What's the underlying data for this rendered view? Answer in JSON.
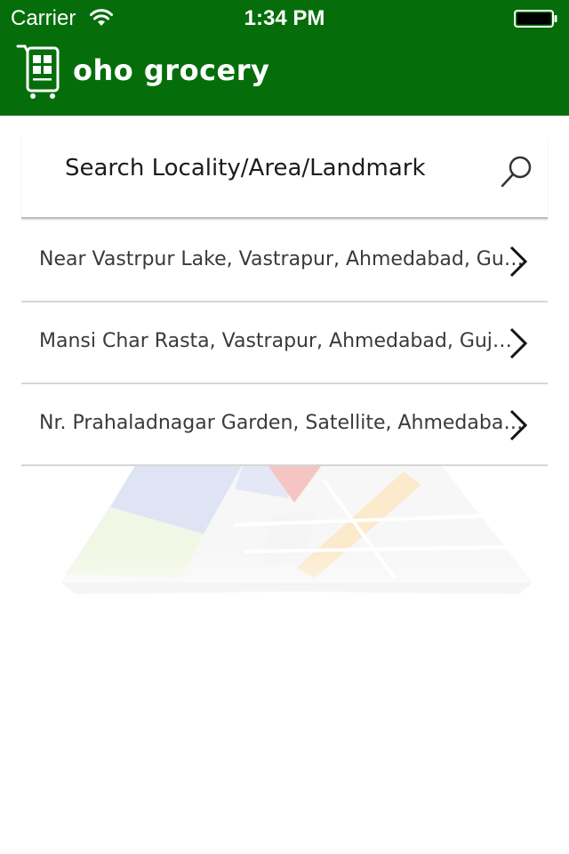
{
  "status_bar": {
    "carrier": "Carrier",
    "time": "1:34 PM",
    "icons": [
      "wifi-icon",
      "battery-icon"
    ]
  },
  "brand": {
    "name": "oho grocery",
    "logo_icon": "grocery-phone-logo-icon",
    "color": "#056e0b"
  },
  "search": {
    "label": "Search Locality/Area/Landmark",
    "icon": "search-icon"
  },
  "results": [
    {
      "label": "Near Vastrpur Lake, Vastrapur, Ahmedabad, Gujarat"
    },
    {
      "label": "Mansi Char Rasta, Vastrapur, Ahmedabad, Gujarat"
    },
    {
      "label": "Nr. Prahaladnagar Garden, Satellite, Ahmedabad, Gujarat"
    }
  ],
  "decoration": {
    "icon": "map-illustration-icon"
  }
}
